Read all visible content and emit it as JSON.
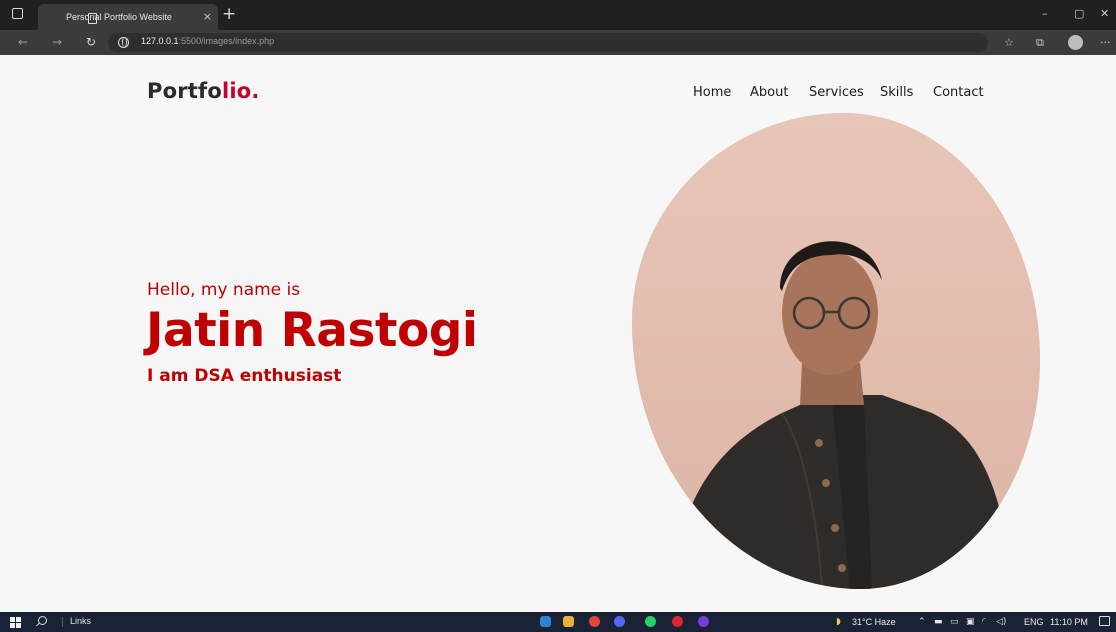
{
  "browser": {
    "tab_title": "Personal Portfolio Website",
    "tab_close": "×",
    "new_tab": "+",
    "url_host": "127.0.0.1",
    "url_path": ":5500/images/index.php",
    "minimize": "–",
    "restore": "▢",
    "close": "✕",
    "more": "···"
  },
  "site": {
    "logo_main": "Portfo",
    "logo_accent": "lio.",
    "nav": [
      "Home",
      "About",
      "Services",
      "Skills",
      "Contact"
    ],
    "greeting": "Hello, my name is",
    "name": "Jatin Rastogi",
    "tagline": "I am DSA enthusiast"
  },
  "taskbar": {
    "links_label": "Links",
    "weather": "31°C Haze",
    "lang": "ENG",
    "time": "11:10 PM"
  },
  "colors": {
    "accent": "#c00000",
    "logo_accent": "#c4002e",
    "page_bg": "#f7f7f7",
    "chrome_dark": "#202020",
    "taskbar_bg": "#1a2336"
  }
}
